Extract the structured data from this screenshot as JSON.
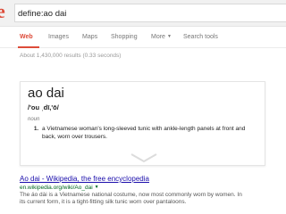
{
  "search": {
    "query": "define:ao dai"
  },
  "tabs": [
    {
      "label": "Web"
    },
    {
      "label": "Images"
    },
    {
      "label": "Maps"
    },
    {
      "label": "Shopping"
    },
    {
      "label": "More"
    },
    {
      "label": "Search tools"
    }
  ],
  "stats": "About 1,430,000 results (0.33 seconds)",
  "definition": {
    "word": "ao dai",
    "phonetic": "/'ou ˌdī,'ō/",
    "part_of_speech": "noun",
    "number": "1.",
    "meaning": "a Vietnamese woman's long-sleeved tunic with ankle-length panels at front and back, worn over trousers."
  },
  "result": {
    "title": "Ao dai - Wikipedia, the free encyclopedia",
    "url": "en.wikipedia.org/wiki/Ao_dai",
    "snippet_line1": "The áo dài is a Vietnamese national costume, now most commonly worn by women. In",
    "snippet_line2": "its current form, it is a tight-fitting silk tunic worn over pantaloons."
  },
  "colors": {
    "accent": "#dd4b39",
    "link": "#1a0dab",
    "url": "#006621"
  }
}
